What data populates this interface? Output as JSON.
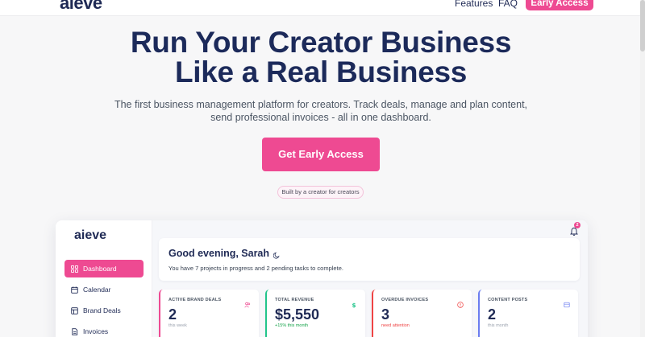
{
  "nav": {
    "logo": "aieve",
    "links": [
      "Features",
      "FAQ"
    ],
    "cta": "Early Access"
  },
  "hero": {
    "title_line1": "Run Your Creator Business",
    "title_line2": "Like a Real Business",
    "subtitle_line1": "The first business management platform for creators. Track deals, manage and plan content,",
    "subtitle_line2": "send professional invoices - all in one dashboard.",
    "cta": "Get Early Access",
    "badge": "Built by a creator for creators"
  },
  "dashboard": {
    "logo": "aieve",
    "notifications_count": "2",
    "sidebar": [
      {
        "label": "Dashboard",
        "icon": "grid-icon",
        "active": true
      },
      {
        "label": "Calendar",
        "icon": "calendar-icon",
        "active": false
      },
      {
        "label": "Brand Deals",
        "icon": "briefcase-icon",
        "active": false
      },
      {
        "label": "Invoices",
        "icon": "document-icon",
        "active": false
      }
    ],
    "greeting": {
      "title": "Good evening, Sarah",
      "subtitle": "You have 7 projects in progress and 2 pending tasks to complete."
    },
    "stats": [
      {
        "label": "ACTIVE BRAND DEALS",
        "value": "2",
        "note": "this week",
        "accent": "#ee4a92",
        "note_color": "#9ca3af",
        "icon": "users-icon"
      },
      {
        "label": "TOTAL REVENUE",
        "value": "$5,550",
        "note": "+15% this month",
        "accent": "#22c58b",
        "note_color": "#16a34a",
        "icon": "dollar-icon"
      },
      {
        "label": "OVERDUE INVOICES",
        "value": "3",
        "note": "need attention",
        "accent": "#ef4444",
        "note_color": "#ef4444",
        "icon": "alert-icon"
      },
      {
        "label": "CONTENT POSTS",
        "value": "2",
        "note": "this month",
        "accent": "#6b7cf0",
        "note_color": "#9ca3af",
        "icon": "image-icon"
      }
    ]
  },
  "colors": {
    "brand": "#ee4a92",
    "navy": "#1f2a55",
    "page_bg": "#f7f7f8"
  }
}
